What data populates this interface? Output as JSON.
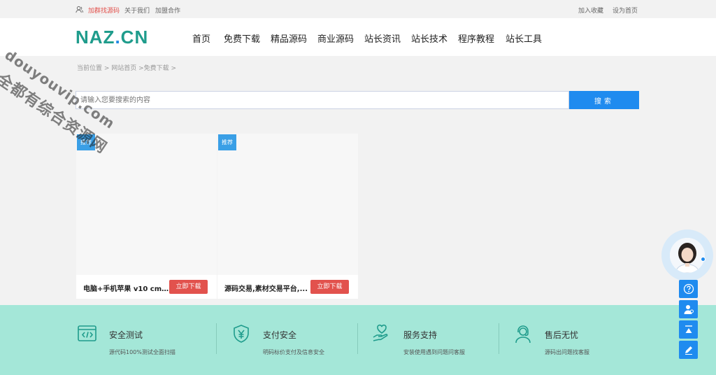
{
  "topbar": {
    "left_links": [
      "加群找源码",
      "关于我们",
      "加盟合作"
    ],
    "right_links": [
      "加入收藏",
      "设为首页"
    ]
  },
  "header": {
    "logo_main": "NAZ",
    "logo_dot": ".",
    "logo_end": "CN",
    "nav": [
      "首页",
      "免费下载",
      "精品源码",
      "商业源码",
      "站长资讯",
      "站长技术",
      "程序教程",
      "站长工具"
    ]
  },
  "breadcrumb": "当前位置 > 网站首页 >免费下载 >",
  "search": {
    "placeholder": "请输入您要搜索的内容",
    "button": "搜索"
  },
  "cards": [
    {
      "tag": "推荐",
      "title": "电脑+手机苹果 v10 cms...",
      "button": "立即下载"
    },
    {
      "tag": "推荐",
      "title": "源码交易,素材交易平台,...",
      "button": "立即下载"
    }
  ],
  "features": [
    {
      "icon": "code-window-icon",
      "title": "安全测试",
      "desc": "源代码100%测试全面扫描"
    },
    {
      "icon": "shield-yen-icon",
      "title": "支付安全",
      "desc": "明码标价支付及信息安全"
    },
    {
      "icon": "heart-hand-icon",
      "title": "服务支持",
      "desc": "安装使用遇到问题问客服"
    },
    {
      "icon": "customer-service-icon",
      "title": "售后无忧",
      "desc": "源码出问题找客服"
    }
  ],
  "watermark": {
    "line1": "全都有综合资源网",
    "line2": "douyouvip.com"
  },
  "colors": {
    "accent_blue": "#1f8bef",
    "accent_red": "#e2524d",
    "logo_teal": "#1f9c8c",
    "footer_band": "#a4e7d8"
  }
}
